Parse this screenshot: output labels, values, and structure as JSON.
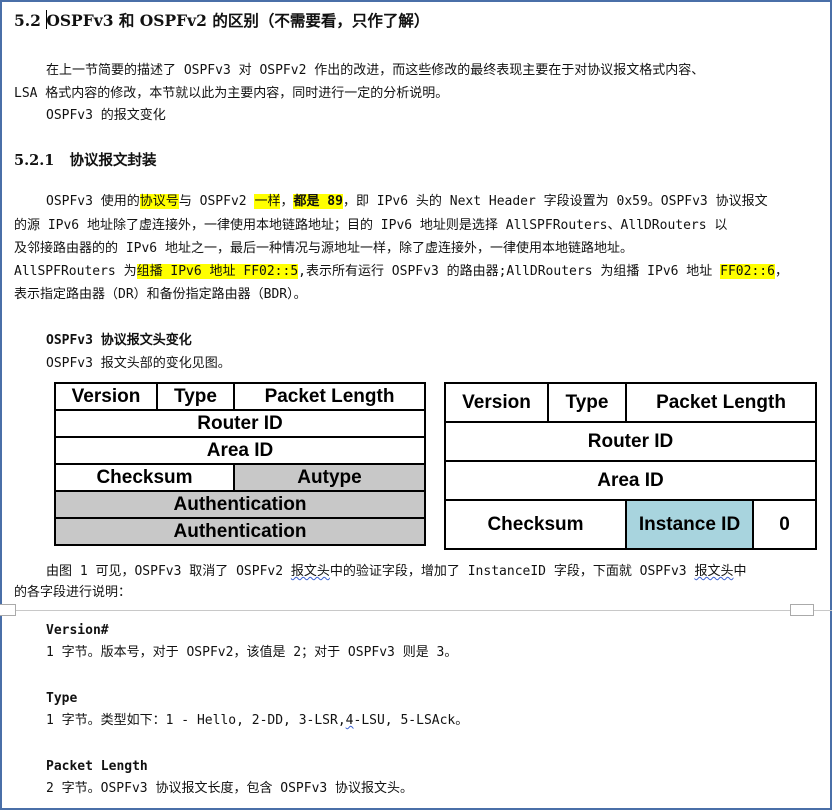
{
  "section_title": "5.2 OSPFv3 和 OSPFv2 的区别（不需要看，只作了解）",
  "intro": {
    "line1": "在上一节简要的描述了 OSPFv3 对 OSPFv2 作出的改进，而这些修改的最终表现主要在于对协议报文格式内容、",
    "line2": "LSA 格式内容的修改，本节就以此为主要内容，同时进行一定的分析说明。",
    "line3": "OSPFv3 的报文变化"
  },
  "subsection": {
    "number": "5.2.1",
    "title": "协议报文封装"
  },
  "para2": {
    "l1_a": "OSPFv3 使用的",
    "l1_hl1": "协议号",
    "l1_b": "与 OSPFv2 ",
    "l1_hl2": "一样",
    "l1_c": "，",
    "l1_hl3": "都是 89",
    "l1_d": "，即 IPv6 头的 Next Header 字段设置为 0x59。OSPFv3 协议报文",
    "l2": "的源 IPv6 地址除了虚连接外，一律使用本地链路地址；目的 IPv6 地址则是选择 AllSPFRouters、AllDRouters 以",
    "l3": "及邻接路由器的的 IPv6 地址之一，最后一种情况与源地址一样，除了虚连接外，一律使用本地链路地址。",
    "l4_a": "AllSPFRouters 为",
    "l4_hl1": "组播 IPv6 地址 FF02::5",
    "l4_b": ",表示所有运行 OSPFv3 的路由器;AllDRouters 为组播 IPv6 地址 ",
    "l4_hl2": "FF02::6",
    "l4_c": "，",
    "l5": "表示指定路由器（DR）和备份指定路由器（BDR）。"
  },
  "header_change": {
    "title": "OSPFv3 协议报文头变化",
    "desc": "OSPFv3 报文头部的变化见图。"
  },
  "diagram_v2": {
    "version": "Version",
    "type": "Type",
    "packet_length": "Packet Length",
    "router_id": "Router ID",
    "area_id": "Area ID",
    "checksum": "Checksum",
    "autype": "Autype",
    "auth1": "Authentication",
    "auth2": "Authentication"
  },
  "diagram_v3": {
    "version": "Version",
    "type": "Type",
    "packet_length": "Packet Length",
    "router_id": "Router ID",
    "area_id": "Area ID",
    "checksum": "Checksum",
    "instance_id": "Instance ID",
    "zero": "0"
  },
  "caption": {
    "l1_a": "由图 1 可见，OSPFv3 取消了 OSPFv2 ",
    "l1_sq1": "报文头",
    "l1_b": "中的验证字段，增加了 InstanceID 字段，下面就 OSPFv3 ",
    "l1_sq2": "报文头",
    "l1_c": "中",
    "l2": "的各字段进行说明："
  },
  "fields": {
    "version_title": "Version#",
    "version_desc": "1 字节。版本号，对于 OSPFv2，该值是 2；对于 OSPFv3 则是 3。",
    "type_title": "Type",
    "type_desc_a": "1 字节。类型如下：1 - Hello, 2-DD, 3-LSR,",
    "type_desc_sq": "4",
    "type_desc_b": "-LSU, 5-LSAck。",
    "plen_title": "Packet Length",
    "plen_desc": "2 字节。OSPFv3 协议报文长度，包含 OSPFv3 协议报文头。"
  }
}
